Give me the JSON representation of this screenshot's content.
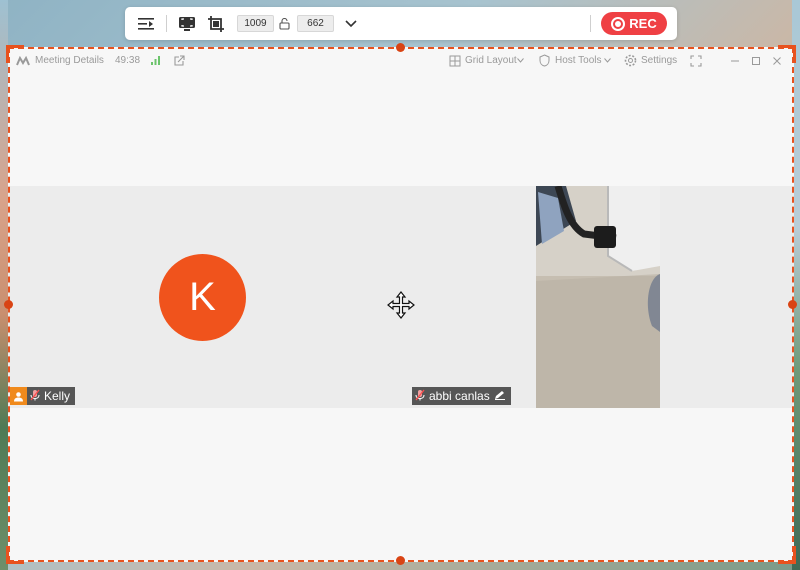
{
  "toolbar": {
    "width_value": "1009",
    "height_value": "662",
    "rec_label": "REC",
    "icons": [
      "collapse-icon",
      "fullscreen-capture-icon",
      "region-capture-icon",
      "lock-ratio-icon",
      "chevron-down-icon",
      "record-icon"
    ]
  },
  "meeting": {
    "title": "Meeting Details",
    "duration": "49:38",
    "grid_layout_label": "Grid Layout",
    "host_tools_label": "Host Tools",
    "settings_label": "Settings",
    "participants": [
      {
        "name": "Kelly",
        "initial": "K",
        "avatar_color": "#f0531c",
        "is_host": true,
        "muted": true
      },
      {
        "name": "abbi canlas",
        "muted": true,
        "video_on": true
      }
    ]
  },
  "colors": {
    "accent": "#e8521e",
    "rec_red": "#ef4044"
  }
}
